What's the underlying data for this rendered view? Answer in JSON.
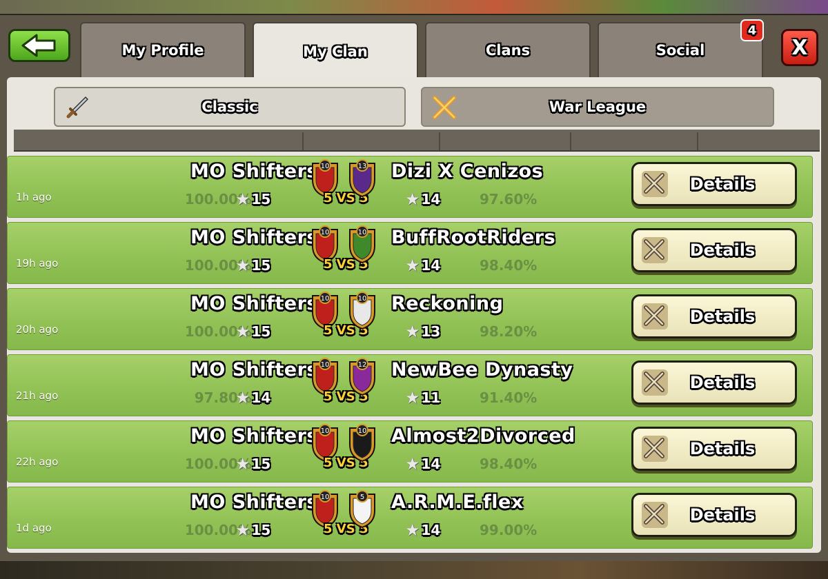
{
  "tabs": [
    {
      "label": "My Profile"
    },
    {
      "label": "My Clan"
    },
    {
      "label": "Clans"
    },
    {
      "label": "Social"
    }
  ],
  "social_badge": "4",
  "close_label": "X",
  "subtabs": {
    "classic": "Classic",
    "war_league": "War League"
  },
  "details_label": "Details",
  "vs_label": "5 VS 5",
  "colors": {
    "row_green": "#92c256",
    "tab_active": "#e9e7e0",
    "close_red": "#d0281a",
    "back_green": "#5cb624"
  },
  "wars": [
    {
      "time": "1h ago",
      "our_clan": "MO Shifters",
      "our_level": "10",
      "our_pct": "100.00%",
      "our_stars": "15",
      "opp_clan": "Dizi X Cenizos",
      "opp_level": "13",
      "opp_pct": "97.60%",
      "opp_stars": "14",
      "opp_badge_color": "#5a2a8a"
    },
    {
      "time": "19h ago",
      "our_clan": "MO Shifters",
      "our_level": "10",
      "our_pct": "100.00%",
      "our_stars": "15",
      "opp_clan": "BuffRootRiders",
      "opp_level": "10",
      "opp_pct": "98.40%",
      "opp_stars": "14",
      "opp_badge_color": "#3e8a2a"
    },
    {
      "time": "20h ago",
      "our_clan": "MO Shifters",
      "our_level": "10",
      "our_pct": "100.00%",
      "our_stars": "15",
      "opp_clan": "Reckoning",
      "opp_level": "10",
      "opp_pct": "98.20%",
      "opp_stars": "13",
      "opp_badge_color": "#e8e8e8"
    },
    {
      "time": "21h ago",
      "our_clan": "MO Shifters",
      "our_level": "10",
      "our_pct": "97.80%",
      "our_stars": "14",
      "opp_clan": "NewBee Dynasty",
      "opp_level": "12",
      "opp_pct": "91.40%",
      "opp_stars": "11",
      "opp_badge_color": "#8a2a9a"
    },
    {
      "time": "22h ago",
      "our_clan": "MO Shifters",
      "our_level": "10",
      "our_pct": "100.00%",
      "our_stars": "15",
      "opp_clan": "Almost2Divorced",
      "opp_level": "10",
      "opp_pct": "98.40%",
      "opp_stars": "14",
      "opp_badge_color": "#1a1a1a"
    },
    {
      "time": "1d ago",
      "our_clan": "MO Shifters",
      "our_level": "10",
      "our_pct": "100.00%",
      "our_stars": "15",
      "opp_clan": "A.R.M.E.flex",
      "opp_level": "5",
      "opp_pct": "99.00%",
      "opp_stars": "14",
      "opp_badge_color": "#f4f4f4"
    }
  ]
}
